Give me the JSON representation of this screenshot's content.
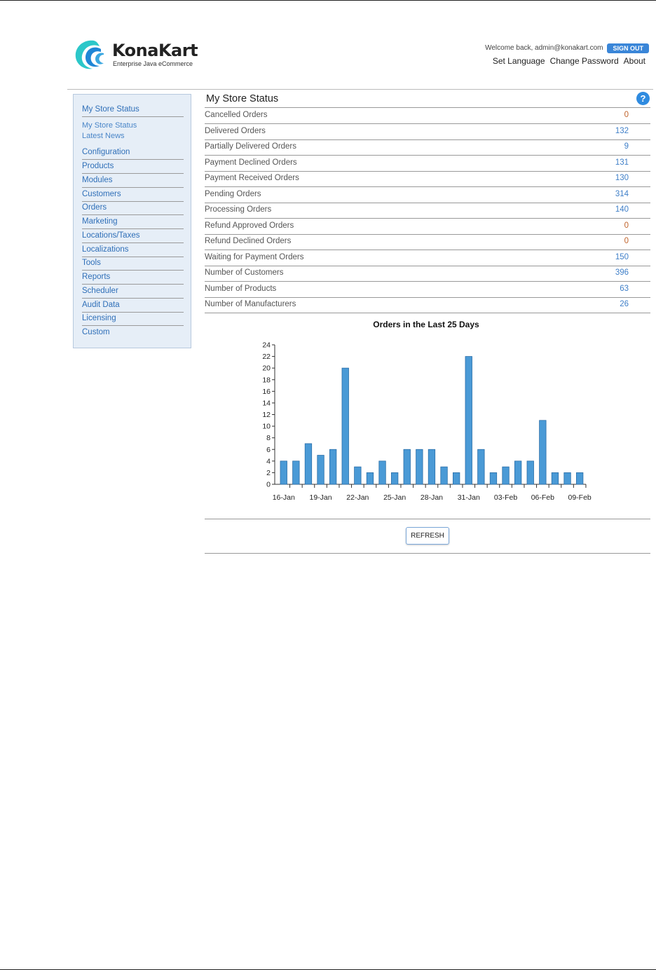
{
  "header": {
    "logo_name": "KonaKart",
    "logo_tagline": "Enterprise Java eCommerce",
    "welcome": "Welcome back, admin@konakart.com",
    "signout_label": "SIGN OUT",
    "links": [
      "Set Language",
      "Change Password",
      "About"
    ]
  },
  "sidebar": {
    "title": "My Store Status",
    "sub_items": [
      "My Store Status",
      "Latest News"
    ],
    "items": [
      "Configuration",
      "Products",
      "Modules",
      "Customers",
      "Orders",
      "Marketing",
      "Locations/Taxes",
      "Localizations",
      "Tools",
      "Reports",
      "Scheduler",
      "Audit Data",
      "Licensing",
      "Custom"
    ]
  },
  "main": {
    "title": "My Store Status",
    "help_glyph": "?",
    "rows": [
      {
        "label": "Cancelled Orders",
        "value": "0"
      },
      {
        "label": "Delivered Orders",
        "value": "132"
      },
      {
        "label": "Partially Delivered Orders",
        "value": "9"
      },
      {
        "label": "Payment Declined Orders",
        "value": "131"
      },
      {
        "label": "Payment Received Orders",
        "value": "130"
      },
      {
        "label": "Pending Orders",
        "value": "314"
      },
      {
        "label": "Processing Orders",
        "value": "140"
      },
      {
        "label": "Refund Approved Orders",
        "value": "0"
      },
      {
        "label": "Refund Declined Orders",
        "value": "0"
      },
      {
        "label": "Waiting for Payment Orders",
        "value": "150"
      },
      {
        "label": "Number of Customers",
        "value": "396"
      },
      {
        "label": "Number of Products",
        "value": "63"
      },
      {
        "label": "Number of Manufacturers",
        "value": "26"
      }
    ],
    "refresh_label": "REFRESH"
  },
  "colors": {
    "accent": "#3a86d8",
    "bar_fill": "#4a9ad6",
    "link": "#2f6fb8",
    "zero_value": "#c0632b",
    "sidebar_bg": "#e6eef7"
  },
  "chart_data": {
    "type": "bar",
    "title": "Orders in the Last 25 Days",
    "xlabel": "",
    "ylabel": "",
    "ylim": [
      0,
      24
    ],
    "yticks": [
      0,
      2,
      4,
      6,
      8,
      10,
      12,
      14,
      16,
      18,
      20,
      22,
      24
    ],
    "categories": [
      "16-Jan",
      "17-Jan",
      "18-Jan",
      "19-Jan",
      "20-Jan",
      "21-Jan",
      "22-Jan",
      "23-Jan",
      "24-Jan",
      "25-Jan",
      "26-Jan",
      "27-Jan",
      "28-Jan",
      "29-Jan",
      "30-Jan",
      "31-Jan",
      "01-Feb",
      "02-Feb",
      "03-Feb",
      "04-Feb",
      "05-Feb",
      "06-Feb",
      "07-Feb",
      "08-Feb",
      "09-Feb"
    ],
    "tick_labels": [
      "16-Jan",
      "19-Jan",
      "22-Jan",
      "25-Jan",
      "28-Jan",
      "31-Jan",
      "03-Feb",
      "06-Feb",
      "09-Feb"
    ],
    "values": [
      4,
      4,
      7,
      5,
      6,
      20,
      3,
      2,
      4,
      2,
      6,
      6,
      6,
      3,
      2,
      22,
      6,
      2,
      3,
      4,
      4,
      11,
      2,
      2,
      2
    ],
    "grid": false,
    "legend": "none"
  }
}
